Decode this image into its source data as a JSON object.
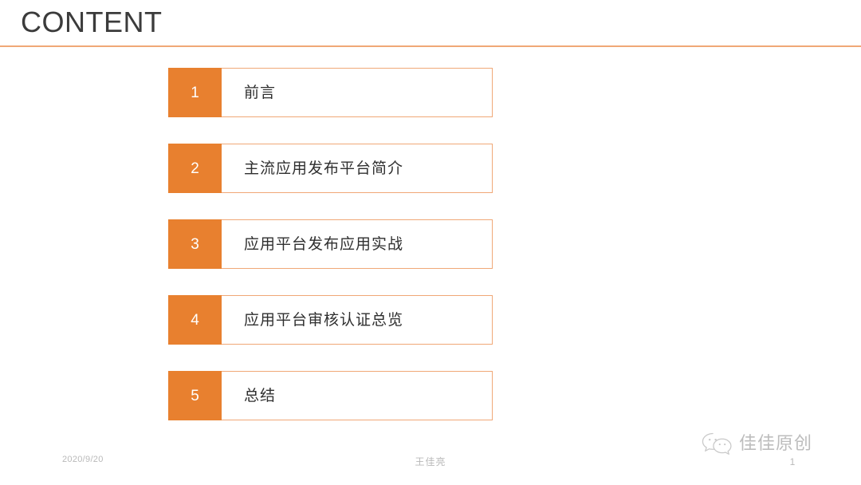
{
  "slide": {
    "title": "CONTENT",
    "accent_color": "#e8802f",
    "rule_color": "#f0a877",
    "text_color": "#2f2f2f",
    "footer_color": "#b9b9b9",
    "background": "#ffffff"
  },
  "content": {
    "items": [
      {
        "number": "1",
        "label": "前言"
      },
      {
        "number": "2",
        "label": "主流应用发布平台简介"
      },
      {
        "number": "3",
        "label": "应用平台发布应用实战"
      },
      {
        "number": "4",
        "label": "应用平台审核认证总览"
      },
      {
        "number": "5",
        "label": "总结"
      }
    ]
  },
  "footer": {
    "date": "2020/9/20",
    "author": "王佳亮",
    "page_number": "1"
  },
  "watermark": {
    "icon": "wechat-icon",
    "text": "佳佳原创"
  }
}
